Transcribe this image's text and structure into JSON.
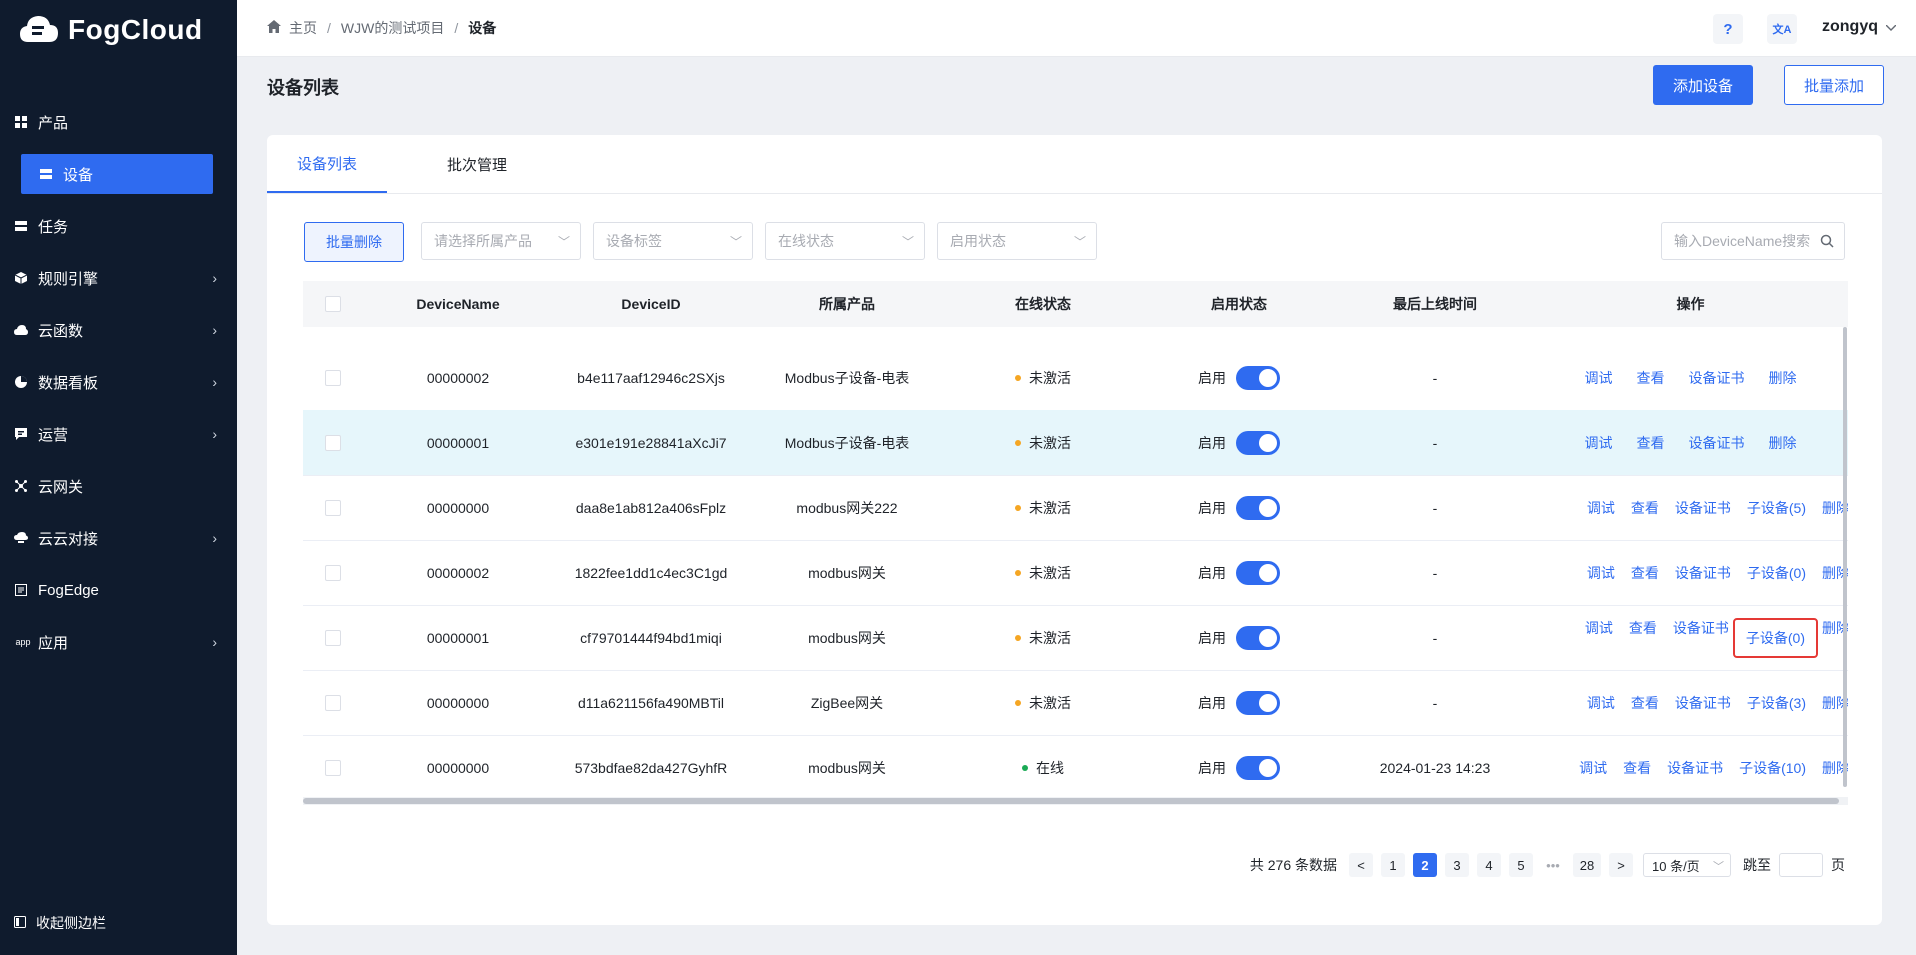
{
  "brand": {
    "name": "FogCloud"
  },
  "sidebar": {
    "items": [
      {
        "label": "产品",
        "icon": "grid-icon",
        "has_children": false
      },
      {
        "label": "设备",
        "icon": "device-icon",
        "has_children": false,
        "active": true
      },
      {
        "label": "任务",
        "icon": "task-icon",
        "has_children": false
      },
      {
        "label": "规则引擎",
        "icon": "cube-icon",
        "has_children": true
      },
      {
        "label": "云函数",
        "icon": "cloud-icon",
        "has_children": true
      },
      {
        "label": "数据看板",
        "icon": "pie-icon",
        "has_children": true
      },
      {
        "label": "运营",
        "icon": "chat-icon",
        "has_children": true
      },
      {
        "label": "云网关",
        "icon": "network-icon",
        "has_children": false
      },
      {
        "label": "云云对接",
        "icon": "cloud-link-icon",
        "has_children": true
      },
      {
        "label": "FogEdge",
        "icon": "edge-icon",
        "has_children": false
      },
      {
        "label": "应用",
        "icon": "app-icon",
        "has_children": true
      }
    ],
    "app_icon_text": "app",
    "collapse_label": "收起侧边栏"
  },
  "header": {
    "breadcrumb": [
      "主页",
      "WJW的测试项目",
      "设备"
    ],
    "help_label": "?",
    "lang_label": "文A",
    "user": "zongyq"
  },
  "page": {
    "title": "设备列表",
    "add_button": "添加设备",
    "batch_add_button": "批量添加"
  },
  "tabs": [
    "设备列表",
    "批次管理"
  ],
  "filters": {
    "batch_delete": "批量删除",
    "product_placeholder": "请选择所属产品",
    "tag_placeholder": "设备标签",
    "online_placeholder": "在线状态",
    "enable_placeholder": "启用状态",
    "search_placeholder": "输入DeviceName搜索"
  },
  "table": {
    "columns": [
      "DeviceName",
      "DeviceID",
      "所属产品",
      "在线状态",
      "启用状态",
      "最后上线时间",
      "操作"
    ],
    "rows": [
      {
        "name": "00000002",
        "id": "b4e117aaf12946c2SXjs",
        "product": "Modbus子设备-电表",
        "online": "未激活",
        "online_color": "#f5a623",
        "enable": "启用",
        "last": "-",
        "ops": [
          "调试",
          "查看",
          "设备证书",
          "删除"
        ]
      },
      {
        "name": "00000001",
        "id": "e301e191e28841aXcJi7",
        "product": "Modbus子设备-电表",
        "online": "未激活",
        "online_color": "#f5a623",
        "enable": "启用",
        "last": "-",
        "ops": [
          "调试",
          "查看",
          "设备证书",
          "删除"
        ],
        "highlight": true
      },
      {
        "name": "00000000",
        "id": "daa8e1ab812a406sFplz",
        "product": "modbus网关222",
        "online": "未激活",
        "online_color": "#f5a623",
        "enable": "启用",
        "last": "-",
        "ops": [
          "调试",
          "查看",
          "设备证书",
          "子设备(5)",
          "删除"
        ]
      },
      {
        "name": "00000002",
        "id": "1822fee1dd1c4ec3C1gd",
        "product": "modbus网关",
        "online": "未激活",
        "online_color": "#f5a623",
        "enable": "启用",
        "last": "-",
        "ops": [
          "调试",
          "查看",
          "设备证书",
          "子设备(0)",
          "删除"
        ]
      },
      {
        "name": "00000001",
        "id": "cf79701444f94bd1miqi",
        "product": "modbus网关",
        "online": "未激活",
        "online_color": "#f5a623",
        "enable": "启用",
        "last": "-",
        "ops": [
          "调试",
          "查看",
          "设备证书",
          "子设备(0)",
          "删除"
        ],
        "boxed_op": 3
      },
      {
        "name": "00000000",
        "id": "d11a621156fa490MBTil",
        "product": "ZigBee网关",
        "online": "未激活",
        "online_color": "#f5a623",
        "enable": "启用",
        "last": "-",
        "ops": [
          "调试",
          "查看",
          "设备证书",
          "子设备(3)",
          "删除"
        ]
      },
      {
        "name": "00000000",
        "id": "573bdfae82da427GyhfR",
        "product": "modbus网关",
        "online": "在线",
        "online_color": "#1aaa55",
        "enable": "启用",
        "last": "2024-01-23 14:23",
        "ops": [
          "调试",
          "查看",
          "设备证书",
          "子设备(10)",
          "删除"
        ]
      }
    ]
  },
  "pagination": {
    "total_label": "共 276 条数据",
    "pages": [
      "1",
      "2",
      "3",
      "4",
      "5",
      "•••",
      "28"
    ],
    "current": "2",
    "prev": "<",
    "next": ">",
    "page_size": "10 条/页",
    "jump_label": "跳至",
    "page_suffix": "页"
  },
  "colors": {
    "accent": "#2f6bf0",
    "sidebar_bg": "#0f1b2d",
    "inactive": "#f5a623",
    "online": "#1aaa55",
    "highlight_box": "#e53935"
  }
}
